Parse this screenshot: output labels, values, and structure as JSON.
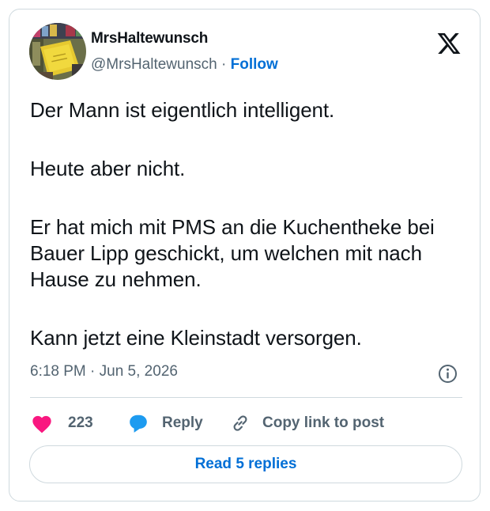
{
  "author": {
    "display_name": "MrsHaltewunsch",
    "handle": "@MrsHaltewunsch",
    "separator": "·",
    "follow_label": "Follow"
  },
  "tweet": {
    "paragraphs": [
      "Der Mann ist eigentlich intelligent.",
      "Heute aber nicht.",
      "Er hat mich mit PMS an die Kuchentheke bei Bauer Lipp geschickt, um welchen mit nach Hause zu nehmen.",
      "Kann jetzt eine Kleinstadt versorgen."
    ],
    "timestamp": "6:18 PM · Jun 5, 2026"
  },
  "actions": {
    "like_count": "223",
    "reply_label": "Reply",
    "copy_link_label": "Copy link to post"
  },
  "read_replies_label": "Read 5 replies",
  "icons": {
    "brand": "x-logo-icon",
    "info": "info-icon",
    "like": "heart-icon",
    "reply": "speech-bubble-icon",
    "copy": "link-icon"
  },
  "colors": {
    "link_blue": "#006fd6",
    "heart_pink": "#f91880",
    "reply_blue": "#1d9bf0",
    "secondary_text": "#536471",
    "border": "#cfd9de"
  }
}
